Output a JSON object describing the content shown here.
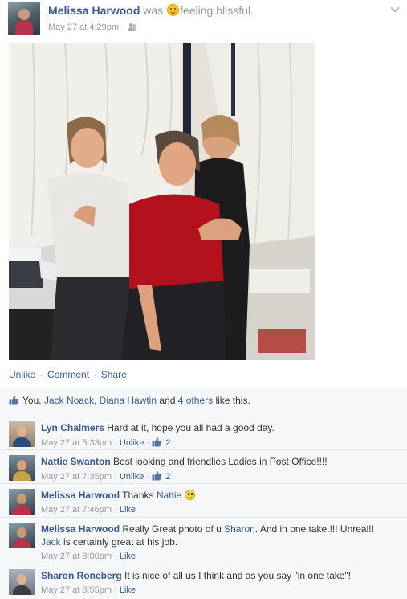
{
  "post": {
    "author": "Melissa Harwood",
    "verb": "was",
    "feeling": "feeling blissful.",
    "timestamp": "May 27 at 4:29pm",
    "separator": "·",
    "actions": {
      "unlike": "Unlike",
      "comment": "Comment",
      "share": "Share",
      "dot": "·"
    }
  },
  "likes": {
    "you": "You,",
    "person1": "Jack Noack",
    "comma": ",",
    "person2": "Diana Hawtin",
    "and": "and",
    "others": "4 others",
    "suffix": "like this."
  },
  "comments": [
    {
      "name": "Lyn Chalmers",
      "text": "Hard at it, hope you all had a good day.",
      "time": "May 27 at 5:33pm",
      "action": "Unlike",
      "like_count": "2"
    },
    {
      "name": "Nattie Swanton",
      "text": "Best looking and friendlies Ladies in Post Office!!!!",
      "time": "May 27 at 7:35pm",
      "action": "Unlike",
      "like_count": "2"
    },
    {
      "name": "Melissa Harwood",
      "text_pre": "Thanks",
      "mention": "Nattie",
      "time": "May 27 at 7:46pm",
      "action": "Like"
    },
    {
      "name": "Melissa Harwood",
      "text_pre": "Really Great photo of u",
      "mention1": "Sharon",
      "text_mid": ". And in one take.!!! Unreal!!",
      "mention2": "Jack",
      "text_post": "is certainly great at his job.",
      "time": "May 27 at 8:00pm",
      "action": "Like"
    },
    {
      "name": "Sharon Roneberg",
      "text": "It is nice of all us I think and as you say \"in one take\"!",
      "time": "May 27 at 8:55pm",
      "action": "Like"
    }
  ],
  "colors": {
    "link": "#3b5998",
    "muted": "#999999",
    "ufi_bg": "#f6f7f9"
  },
  "icons": {
    "feeling": "smiley-icon",
    "audience": "friends-icon",
    "menu": "chevron-down-icon",
    "like": "thumbs-up-icon"
  }
}
